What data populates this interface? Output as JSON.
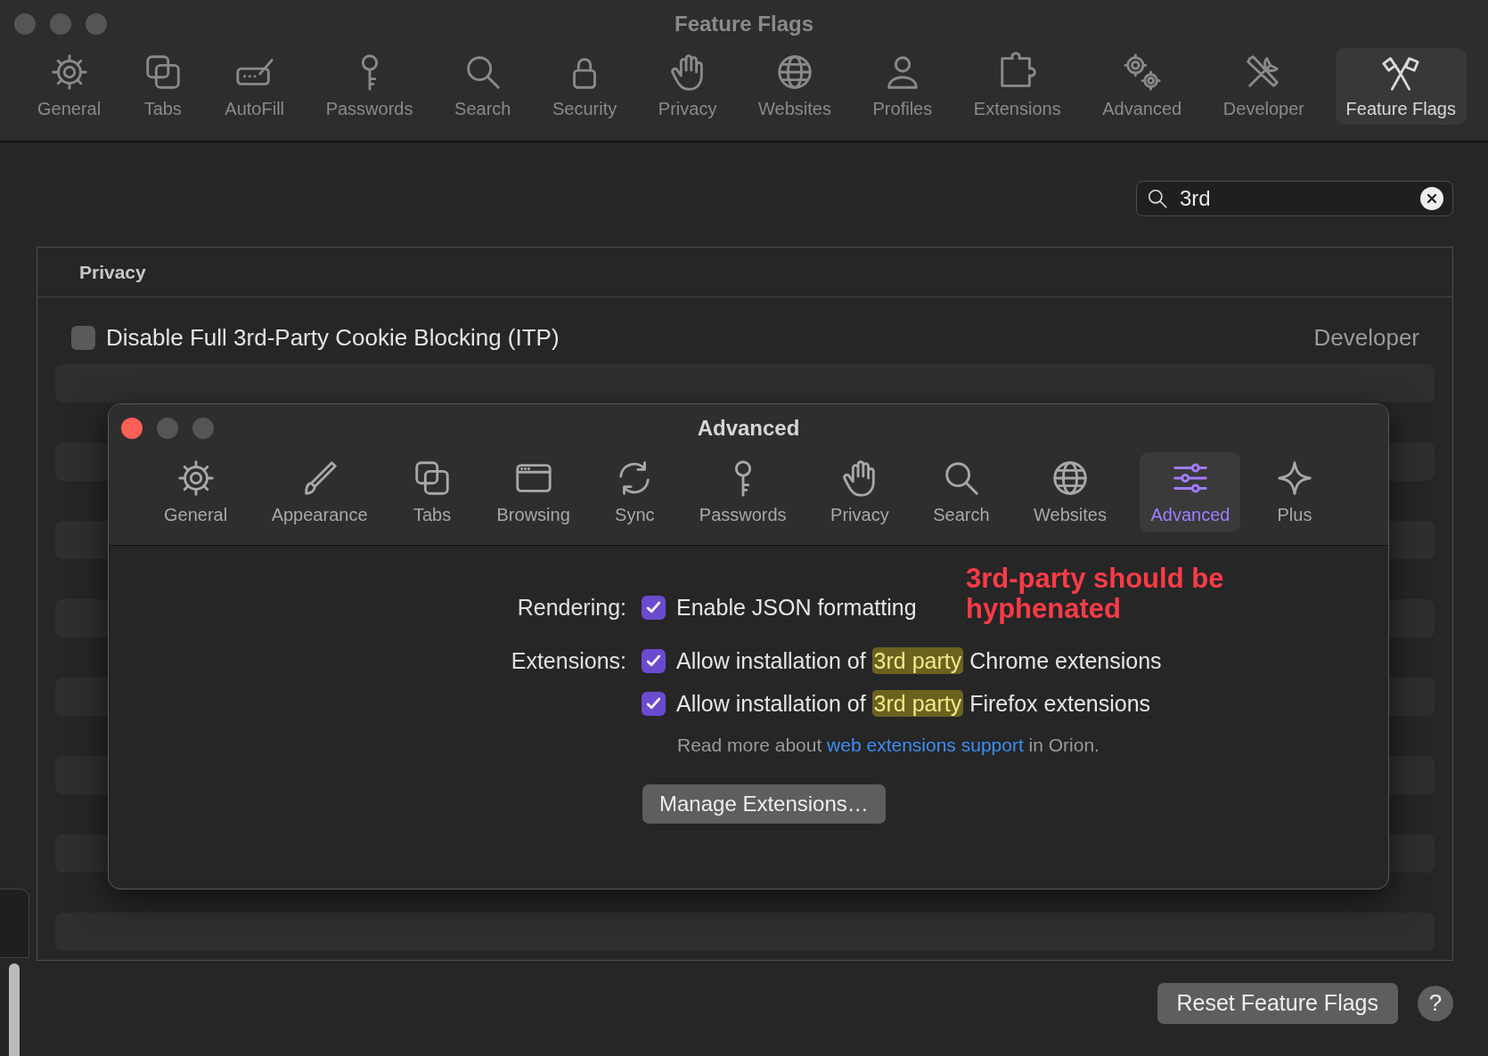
{
  "window": {
    "title": "Feature Flags"
  },
  "toolbar": [
    {
      "label": "General",
      "selected": false
    },
    {
      "label": "Tabs",
      "selected": false
    },
    {
      "label": "AutoFill",
      "selected": false
    },
    {
      "label": "Passwords",
      "selected": false
    },
    {
      "label": "Search",
      "selected": false
    },
    {
      "label": "Security",
      "selected": false
    },
    {
      "label": "Privacy",
      "selected": false
    },
    {
      "label": "Websites",
      "selected": false
    },
    {
      "label": "Profiles",
      "selected": false
    },
    {
      "label": "Extensions",
      "selected": false
    },
    {
      "label": "Advanced",
      "selected": false
    },
    {
      "label": "Developer",
      "selected": false
    },
    {
      "label": "Feature Flags",
      "selected": true
    }
  ],
  "search": {
    "value": "3rd"
  },
  "section": {
    "title": "Privacy",
    "flags": [
      {
        "label": "Disable Full 3rd-Party Cookie Blocking (ITP)",
        "checked": false,
        "category": "Developer"
      }
    ]
  },
  "dialog": {
    "title": "Advanced",
    "toolbar": [
      {
        "label": "General",
        "selected": false
      },
      {
        "label": "Appearance",
        "selected": false
      },
      {
        "label": "Tabs",
        "selected": false
      },
      {
        "label": "Browsing",
        "selected": false
      },
      {
        "label": "Sync",
        "selected": false
      },
      {
        "label": "Passwords",
        "selected": false
      },
      {
        "label": "Privacy",
        "selected": false
      },
      {
        "label": "Search",
        "selected": false
      },
      {
        "label": "Websites",
        "selected": false
      },
      {
        "label": "Advanced",
        "selected": true
      },
      {
        "label": "Plus",
        "selected": false
      }
    ],
    "settings": [
      {
        "label": "Rendering:",
        "options": [
          {
            "text": "Enable JSON formatting",
            "checked": true
          }
        ]
      },
      {
        "label": "Extensions:",
        "options": [
          {
            "text": "Allow installation of ",
            "match": "3rd party",
            "rest": " Chrome extensions",
            "checked": true
          },
          {
            "text": "Allow installation of ",
            "match": "3rd party",
            "rest": " Firefox extensions",
            "checked": true
          }
        ]
      }
    ],
    "note": {
      "text": "Read more about ",
      "link": "web extensions support",
      "rest": " in Orion."
    },
    "button": "Manage Extensions…",
    "annotation": "3rd-party should be hyphenated"
  },
  "footer": {
    "reset": "Reset Feature Flags",
    "help": "?"
  }
}
